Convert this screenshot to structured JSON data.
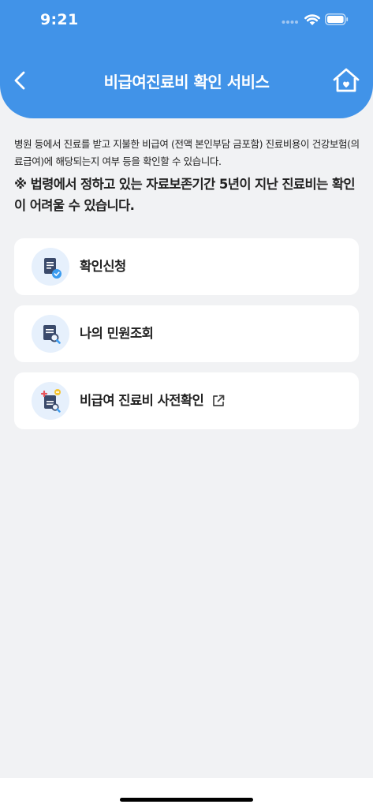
{
  "status_bar": {
    "time": "9:21"
  },
  "header": {
    "title": "비급여진료비 확인 서비스"
  },
  "description": "병원 등에서 진료를 받고 지불한 비급여 (전액 본인부담 금포함) 진료비용이 건강보험(의료급여)에 해당되는지 여부 등을 확인할 수 있습니다.",
  "notice": "※ 법령에서 정하고 있는 자료보존기간 5년이 지난 진료비는 확인이 어려울 수 있습니다.",
  "menu": [
    {
      "label": "확인신청",
      "icon": "document-check-icon"
    },
    {
      "label": "나의 민원조회",
      "icon": "document-search-icon"
    },
    {
      "label": "비급여 진료비 사전확인",
      "icon": "medical-document-search-icon",
      "external": true
    }
  ],
  "colors": {
    "accent": "#4193e8",
    "background": "#f1f2f4",
    "icon_bg": "#e6f0fc"
  }
}
